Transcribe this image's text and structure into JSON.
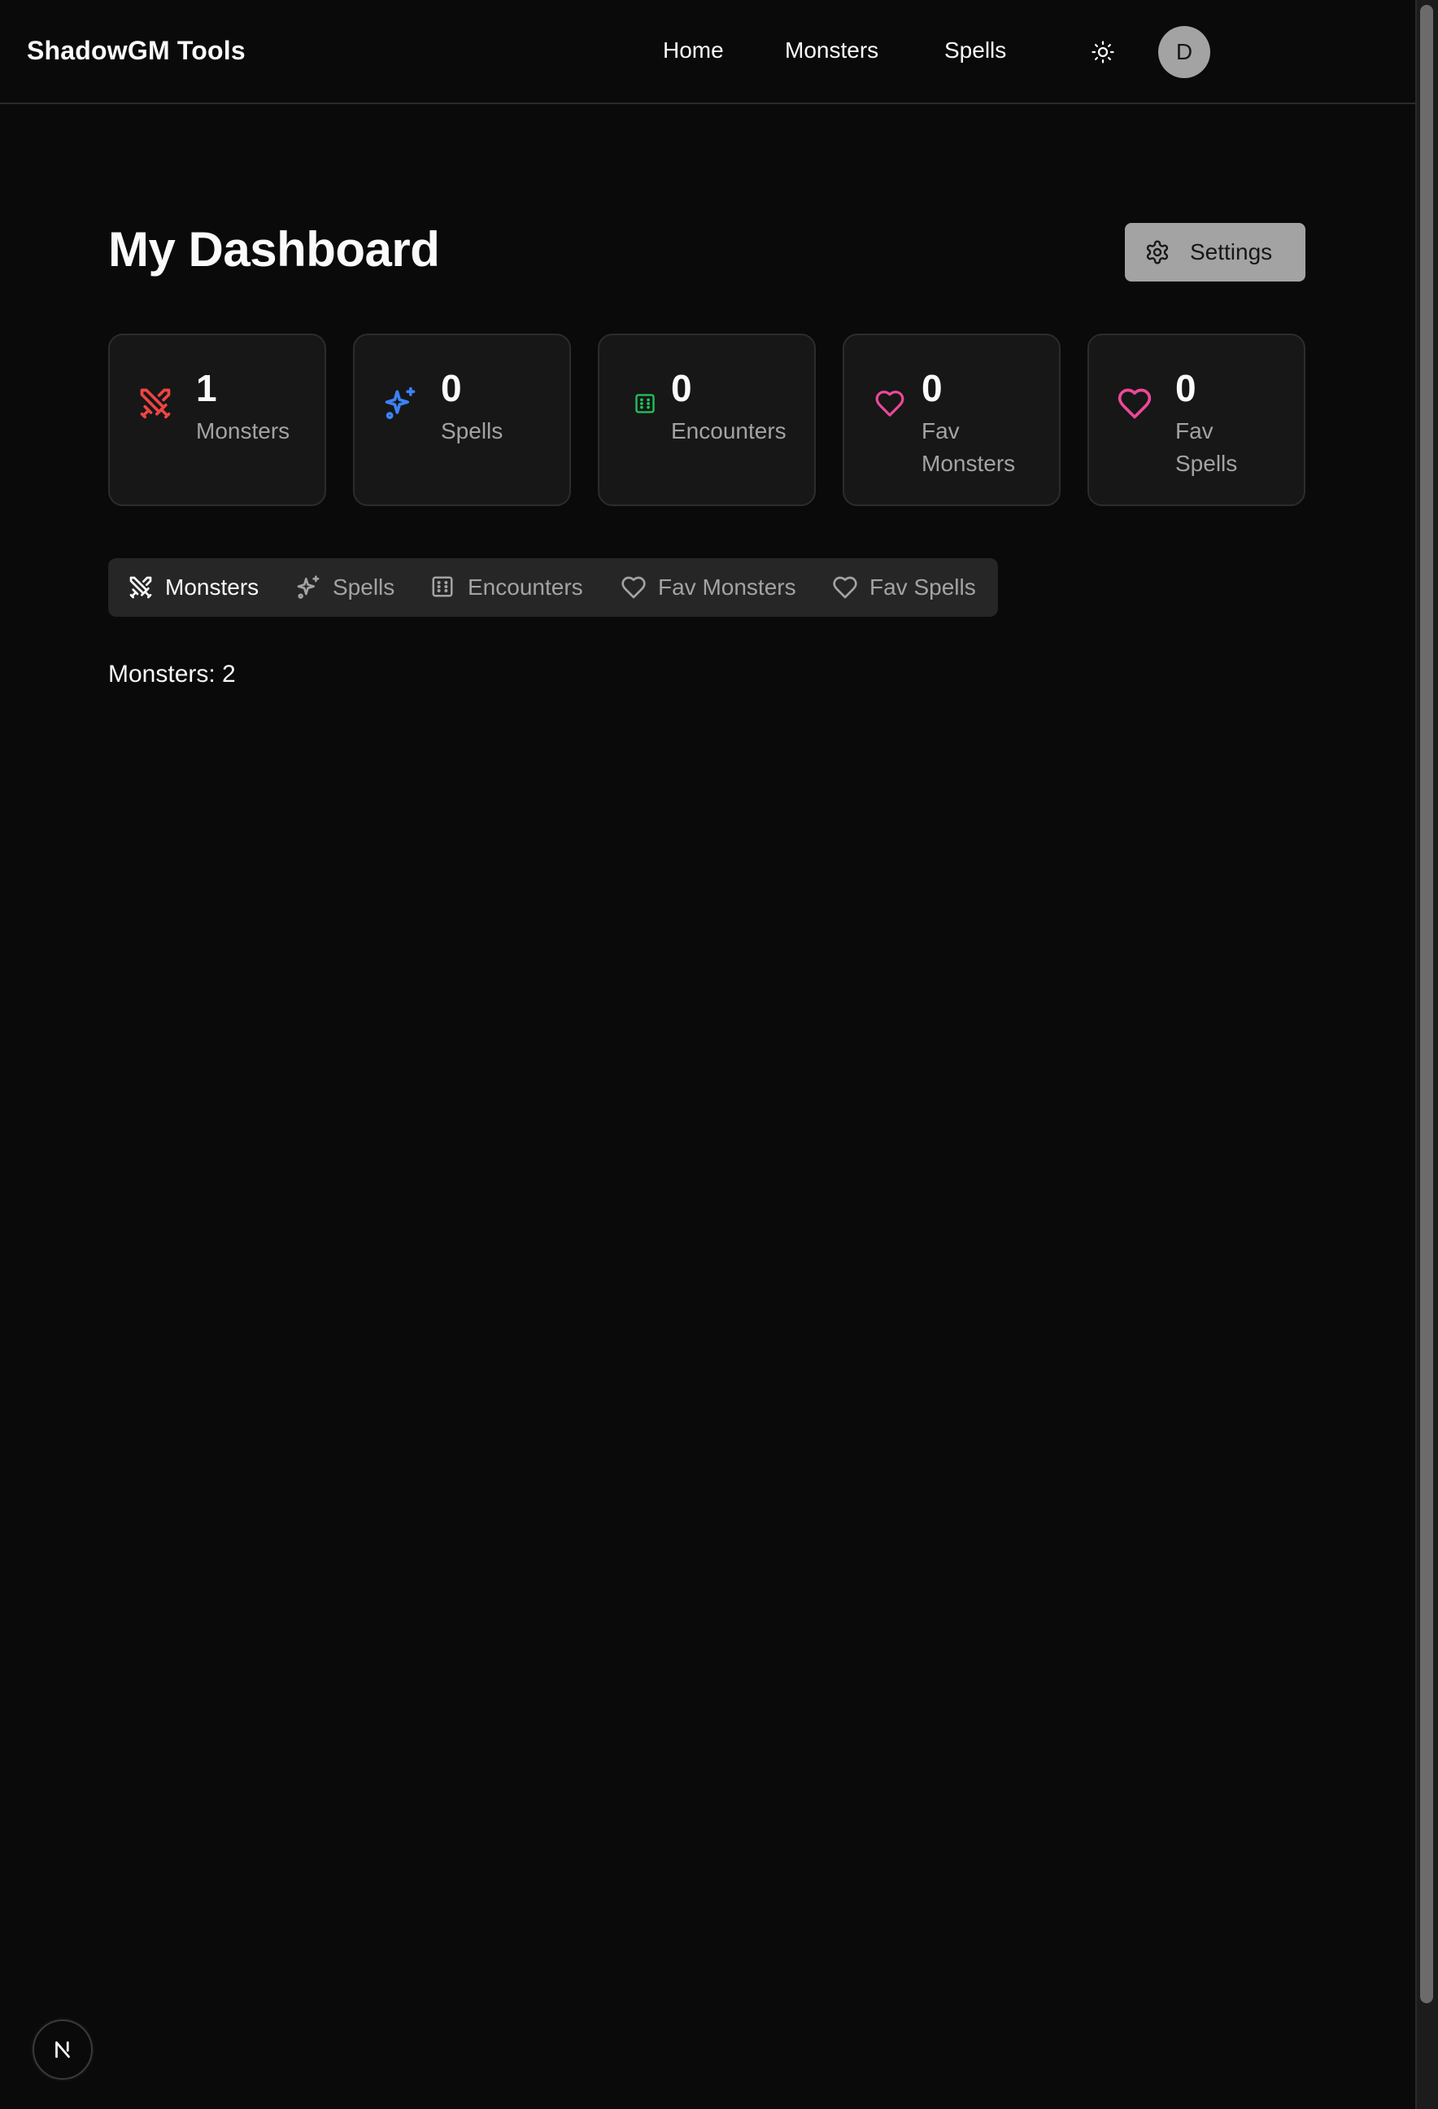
{
  "header": {
    "brand": "ShadowGM Tools",
    "nav": [
      {
        "label": "Home"
      },
      {
        "label": "Monsters"
      },
      {
        "label": "Spells"
      }
    ],
    "theme_icon": "sun-icon",
    "avatar_initial": "D"
  },
  "main": {
    "title": "My Dashboard",
    "settings_label": "Settings",
    "stats": [
      {
        "value": "1",
        "label": "Monsters",
        "icon": "swords-icon",
        "color": "#ef4444"
      },
      {
        "value": "0",
        "label": "Spells",
        "icon": "sparkles-icon",
        "color": "#3b82f6"
      },
      {
        "value": "0",
        "label": "Encounters",
        "icon": "dice-icon",
        "color": "#22c55e"
      },
      {
        "value": "0",
        "label": "Fav Monsters",
        "icon": "heart-icon",
        "color": "#ec4899"
      },
      {
        "value": "0",
        "label": "Fav Spells",
        "icon": "heart-icon",
        "color": "#ec4899"
      }
    ],
    "tabs": [
      {
        "label": "Monsters",
        "icon": "swords-icon",
        "active": true
      },
      {
        "label": "Spells",
        "icon": "sparkles-icon"
      },
      {
        "label": "Encounters",
        "icon": "dice-icon"
      },
      {
        "label": "Fav Monsters",
        "icon": "heart-icon"
      },
      {
        "label": "Fav Spells",
        "icon": "heart-icon"
      }
    ],
    "content_text": "Monsters: 2"
  },
  "badge": {
    "label": "N"
  },
  "colors": {
    "background": "#0a0a0a",
    "card": "#171717",
    "muted_text": "#a3a3a3"
  }
}
